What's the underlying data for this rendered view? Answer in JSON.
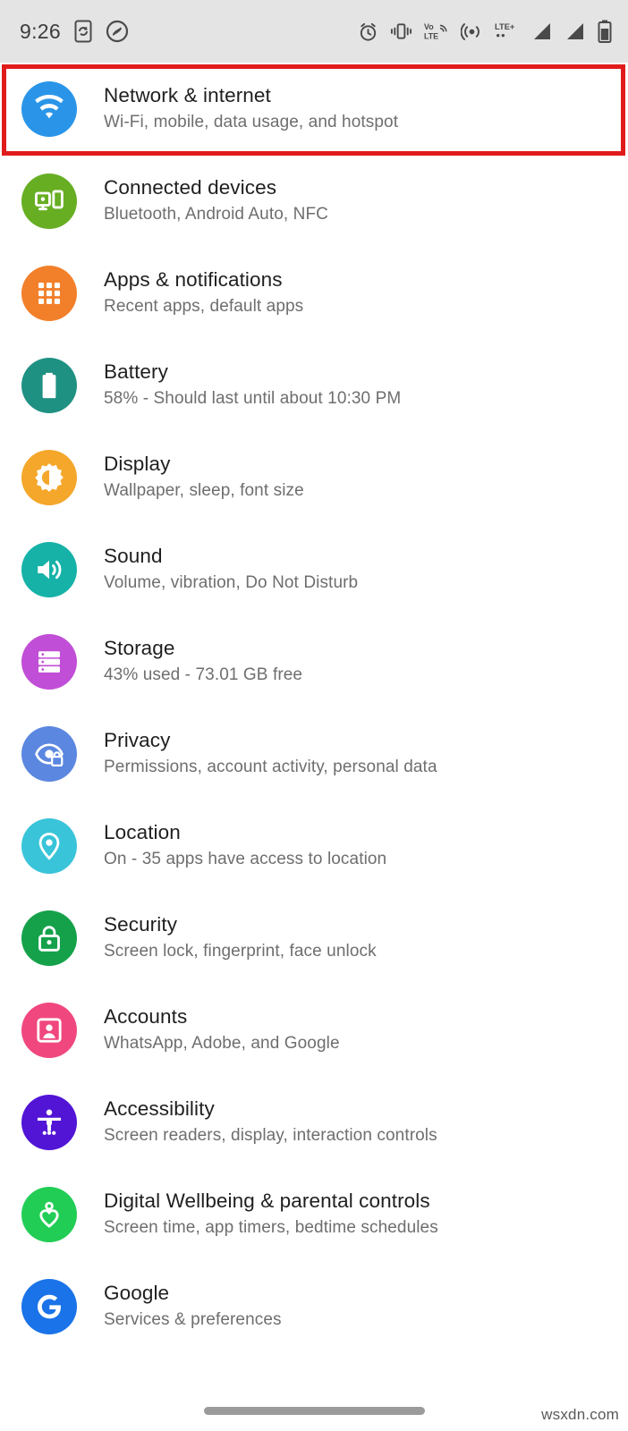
{
  "status_bar": {
    "clock": "9:26",
    "left_icons": [
      {
        "name": "phone-sync-icon",
        "label": "phone sync"
      },
      {
        "name": "shazam-icon",
        "label": "Shazam"
      }
    ],
    "right_icons": [
      {
        "name": "alarm-icon",
        "label": "alarm"
      },
      {
        "name": "vibrate-icon",
        "label": "vibrate"
      },
      {
        "name": "volte-icon",
        "label": "VoLTE"
      },
      {
        "name": "hotspot-icon",
        "label": "hotspot"
      },
      {
        "name": "lte-plus-icon",
        "label": "LTE+"
      },
      {
        "name": "signal-bars-sim1-icon",
        "label": "signal SIM 1"
      },
      {
        "name": "signal-bars-sim2-icon",
        "label": "signal SIM 2"
      },
      {
        "name": "battery-icon",
        "label": "battery"
      }
    ],
    "volte_line1": "Vo",
    "volte_line2": "LTE",
    "lte_label": "LTE+",
    "background": "#e4e4e4"
  },
  "highlight": {
    "color": "#e01b1b",
    "target": "Network & internet"
  },
  "settings": {
    "items": [
      {
        "id": "network-internet",
        "title": "Network & internet",
        "subtitle": "Wi-Fi, mobile, data usage, and hotspot",
        "icon": "wifi-icon",
        "color": "#2a95e8",
        "highlighted": true
      },
      {
        "id": "connected-devices",
        "title": "Connected devices",
        "subtitle": "Bluetooth, Android Auto, NFC",
        "icon": "connected-devices-icon",
        "color": "#67ae23",
        "highlighted": false
      },
      {
        "id": "apps-notifications",
        "title": "Apps & notifications",
        "subtitle": "Recent apps, default apps",
        "icon": "apps-grid-icon",
        "color": "#f2802b",
        "highlighted": false
      },
      {
        "id": "battery",
        "title": "Battery",
        "subtitle": "58% - Should last until about 10:30 PM",
        "icon": "battery-icon",
        "color": "#1f9183",
        "highlighted": false
      },
      {
        "id": "display",
        "title": "Display",
        "subtitle": "Wallpaper, sleep, font size",
        "icon": "brightness-icon",
        "color": "#f4a72b",
        "highlighted": false
      },
      {
        "id": "sound",
        "title": "Sound",
        "subtitle": "Volume, vibration, Do Not Disturb",
        "icon": "speaker-icon",
        "color": "#16b2a8",
        "highlighted": false
      },
      {
        "id": "storage",
        "title": "Storage",
        "subtitle": "43% used - 73.01 GB free",
        "icon": "storage-icon",
        "color": "#c14ed6",
        "highlighted": false
      },
      {
        "id": "privacy",
        "title": "Privacy",
        "subtitle": "Permissions, account activity, personal data",
        "icon": "privacy-eye-lock-icon",
        "color": "#5b87e0",
        "highlighted": false
      },
      {
        "id": "location",
        "title": "Location",
        "subtitle": "On - 35 apps have access to location",
        "icon": "location-pin-icon",
        "color": "#39c4d9",
        "highlighted": false
      },
      {
        "id": "security",
        "title": "Security",
        "subtitle": "Screen lock, fingerprint, face unlock",
        "icon": "lock-icon",
        "color": "#15a14a",
        "highlighted": false
      },
      {
        "id": "accounts",
        "title": "Accounts",
        "subtitle": "WhatsApp, Adobe, and Google",
        "icon": "account-card-icon",
        "color": "#f0487e",
        "highlighted": false
      },
      {
        "id": "accessibility",
        "title": "Accessibility",
        "subtitle": "Screen readers, display, interaction controls",
        "icon": "accessibility-person-icon",
        "color": "#5215d6",
        "highlighted": false
      },
      {
        "id": "digital-wellbeing",
        "title": "Digital Wellbeing & parental controls",
        "subtitle": "Screen time, app timers, bedtime schedules",
        "icon": "wellbeing-heart-icon",
        "color": "#22cd55",
        "highlighted": false
      },
      {
        "id": "google",
        "title": "Google",
        "subtitle": "Services & preferences",
        "icon": "google-g-icon",
        "color": "#1a73e8",
        "highlighted": false
      }
    ]
  },
  "nav_bar": {
    "pill": "home-gesture-pill"
  },
  "watermark": {
    "text": "wsxdn.com"
  }
}
